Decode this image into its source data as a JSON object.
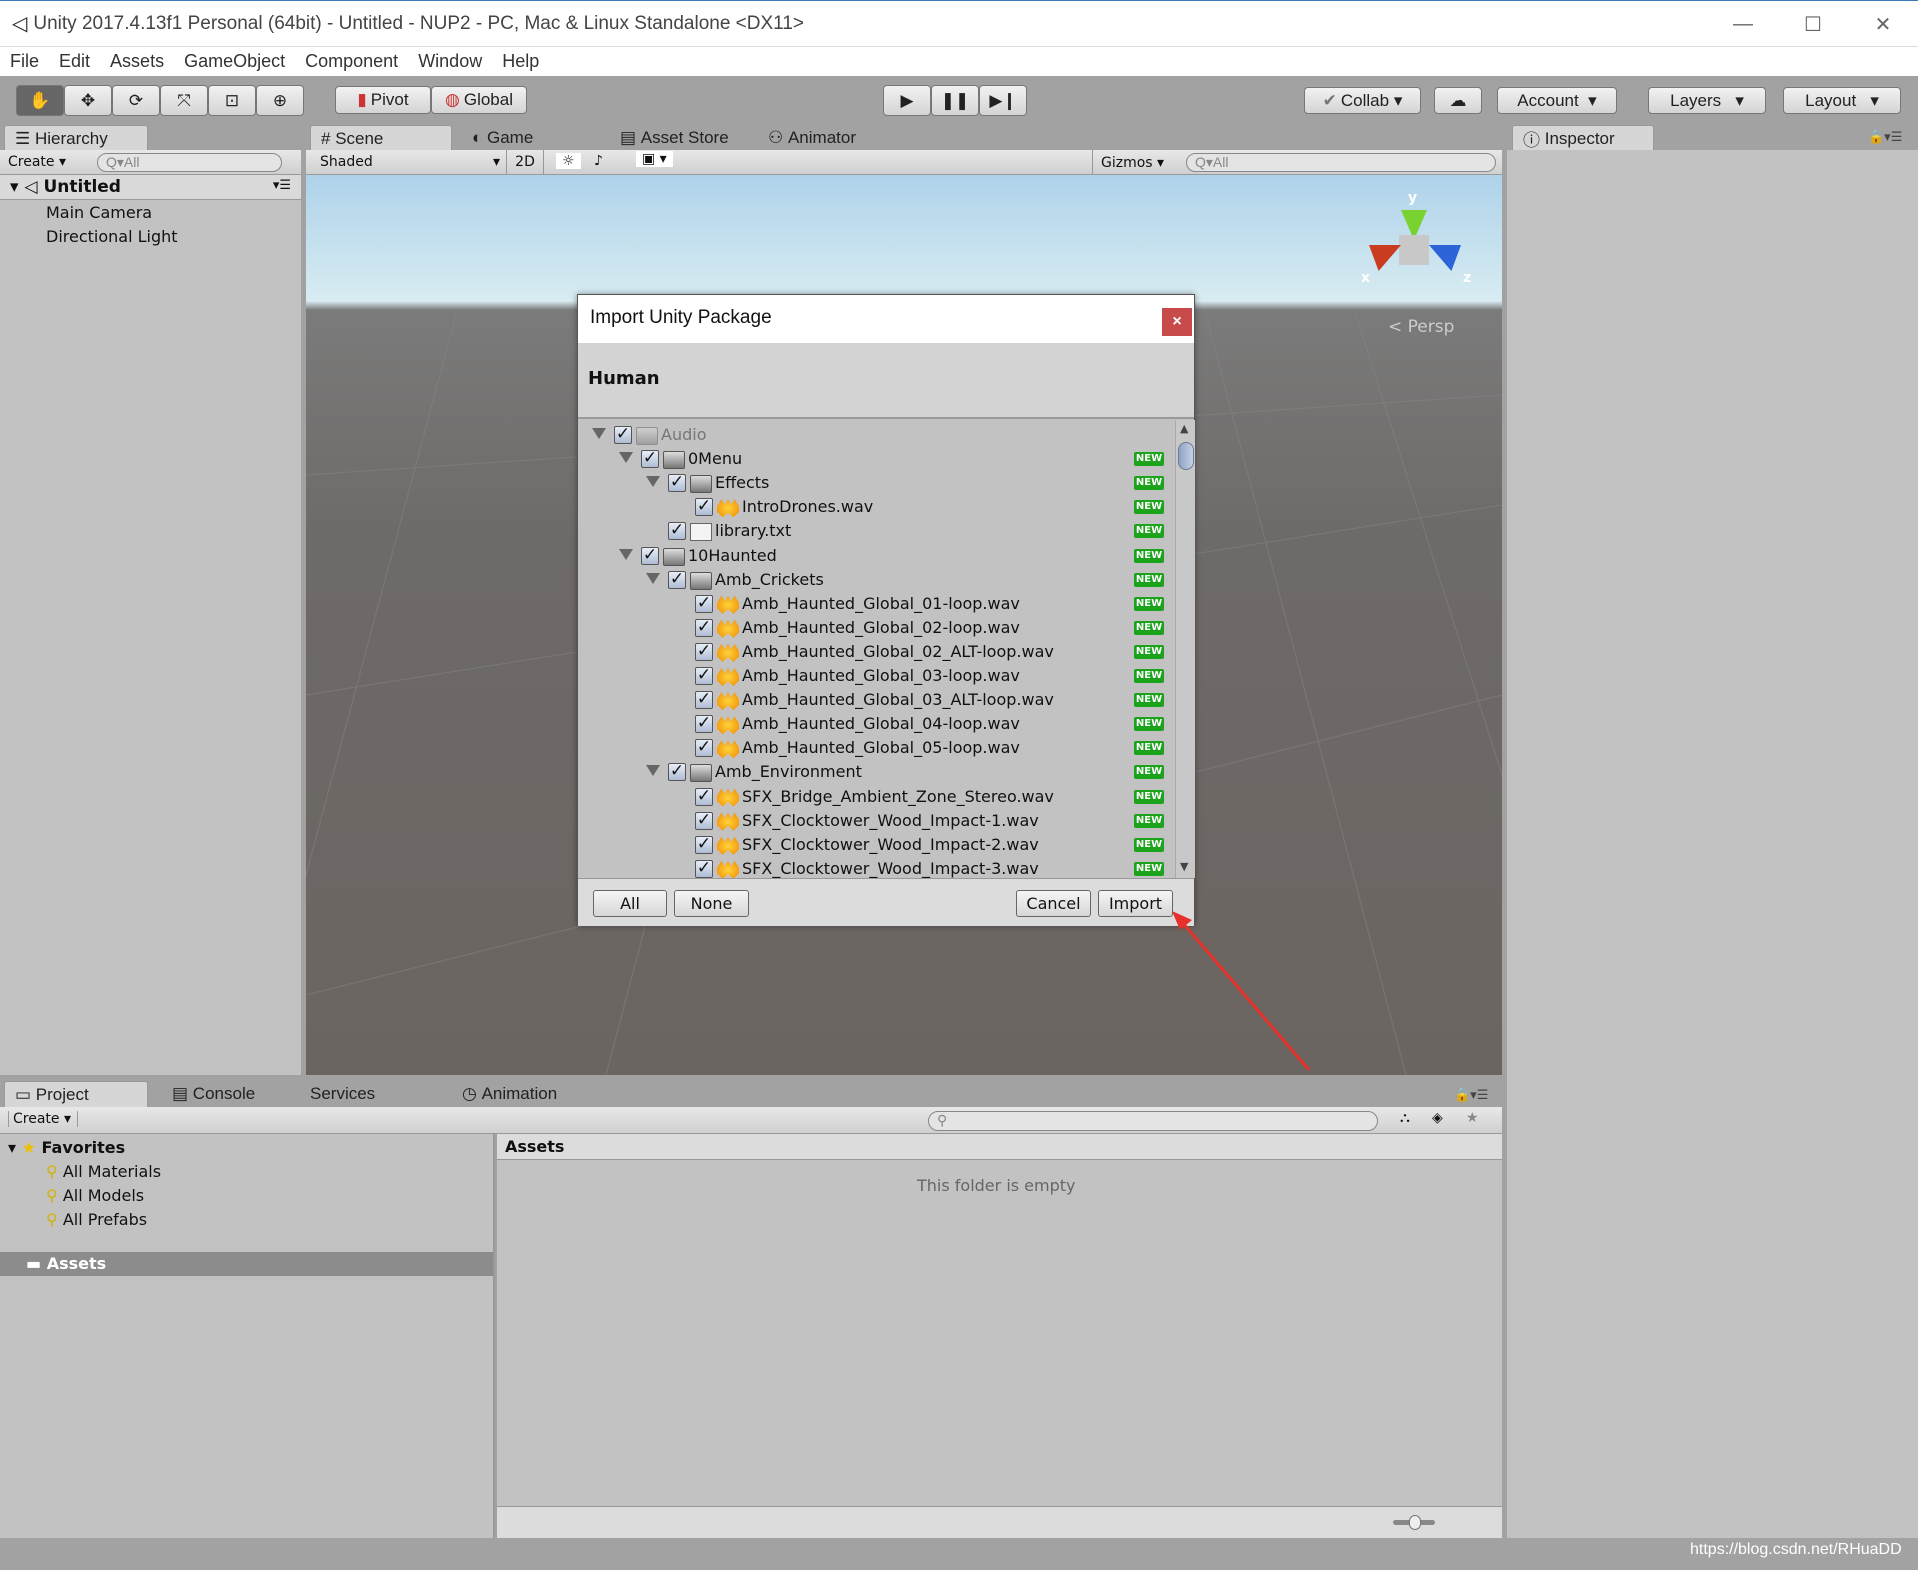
{
  "window": {
    "title": "Unity 2017.4.13f1 Personal (64bit) - Untitled - NUP2 - PC, Mac & Linux Standalone <DX11>",
    "minimize": "—",
    "maximize": "☐",
    "close": "✕"
  },
  "menu": [
    "File",
    "Edit",
    "Assets",
    "GameObject",
    "Component",
    "Window",
    "Help"
  ],
  "toolbar": {
    "tools": [
      "hand-tool",
      "move-tool",
      "rotate-tool",
      "scale-tool",
      "rect-tool",
      "transform-tool"
    ],
    "pivot": "Pivot",
    "global": "Global",
    "collab": "Collab",
    "account": "Account",
    "layers": "Layers",
    "layout": "Layout"
  },
  "hierarchy": {
    "tab": "Hierarchy",
    "create": "Create",
    "search_placeholder": "All",
    "scene": "Untitled",
    "items": [
      "Main Camera",
      "Directional Light"
    ]
  },
  "scene_tabs": [
    "Scene",
    "Game",
    "Asset Store",
    "Animator"
  ],
  "scene_toolbar": {
    "shading": "Shaded",
    "mode2d": "2D",
    "gizmos": "Gizmos",
    "search_placeholder": "All"
  },
  "gizmo": {
    "y": "y",
    "x": "x",
    "z": "z",
    "projection": "Persp"
  },
  "inspector": {
    "tab": "Inspector"
  },
  "dialog": {
    "title": "Import Unity Package",
    "close": "×",
    "package": "Human",
    "new_badge": "NEW",
    "items": [
      {
        "level": 0,
        "type": "folder",
        "name": "Audio",
        "checked": true,
        "expanded": true,
        "dim": true,
        "new": false
      },
      {
        "level": 1,
        "type": "folder",
        "name": "0Menu",
        "checked": true,
        "expanded": true,
        "new": true
      },
      {
        "level": 2,
        "type": "folder",
        "name": "Effects",
        "checked": true,
        "expanded": true,
        "new": true
      },
      {
        "level": 3,
        "type": "audio",
        "name": "IntroDrones.wav",
        "checked": true,
        "new": true
      },
      {
        "level": 2,
        "type": "text",
        "name": "library.txt",
        "checked": true,
        "new": true
      },
      {
        "level": 1,
        "type": "folder",
        "name": "10Haunted",
        "checked": true,
        "expanded": true,
        "new": true
      },
      {
        "level": 2,
        "type": "folder",
        "name": "Amb_Crickets",
        "checked": true,
        "expanded": true,
        "new": true
      },
      {
        "level": 3,
        "type": "audio",
        "name": "Amb_Haunted_Global_01-loop.wav",
        "checked": true,
        "new": true
      },
      {
        "level": 3,
        "type": "audio",
        "name": "Amb_Haunted_Global_02-loop.wav",
        "checked": true,
        "new": true
      },
      {
        "level": 3,
        "type": "audio",
        "name": "Amb_Haunted_Global_02_ALT-loop.wav",
        "checked": true,
        "new": true
      },
      {
        "level": 3,
        "type": "audio",
        "name": "Amb_Haunted_Global_03-loop.wav",
        "checked": true,
        "new": true
      },
      {
        "level": 3,
        "type": "audio",
        "name": "Amb_Haunted_Global_03_ALT-loop.wav",
        "checked": true,
        "new": true
      },
      {
        "level": 3,
        "type": "audio",
        "name": "Amb_Haunted_Global_04-loop.wav",
        "checked": true,
        "new": true
      },
      {
        "level": 3,
        "type": "audio",
        "name": "Amb_Haunted_Global_05-loop.wav",
        "checked": true,
        "new": true
      },
      {
        "level": 2,
        "type": "folder",
        "name": "Amb_Environment",
        "checked": true,
        "expanded": true,
        "new": true
      },
      {
        "level": 3,
        "type": "audio",
        "name": "SFX_Bridge_Ambient_Zone_Stereo.wav",
        "checked": true,
        "new": true
      },
      {
        "level": 3,
        "type": "audio",
        "name": "SFX_Clocktower_Wood_Impact-1.wav",
        "checked": true,
        "new": true
      },
      {
        "level": 3,
        "type": "audio",
        "name": "SFX_Clocktower_Wood_Impact-2.wav",
        "checked": true,
        "new": true
      },
      {
        "level": 3,
        "type": "audio",
        "name": "SFX_Clocktower_Wood_Impact-3.wav",
        "checked": true,
        "new": true
      }
    ],
    "buttons": {
      "all": "All",
      "none": "None",
      "cancel": "Cancel",
      "import": "Import"
    }
  },
  "bottom_tabs": [
    "Project",
    "Console",
    "Services",
    "Animation"
  ],
  "project": {
    "create": "Create",
    "favorites": "Favorites",
    "favorite_items": [
      "All Materials",
      "All Models",
      "All Prefabs"
    ],
    "assets_folder": "Assets",
    "breadcrumb": "Assets",
    "empty_message": "This folder is empty"
  },
  "watermark": "https://blog.csdn.net/RHuaDD",
  "colors": {
    "annotation_arrow": "#e8302a",
    "new_badge": "#1ca31c",
    "close_button": "#c74b4b"
  }
}
